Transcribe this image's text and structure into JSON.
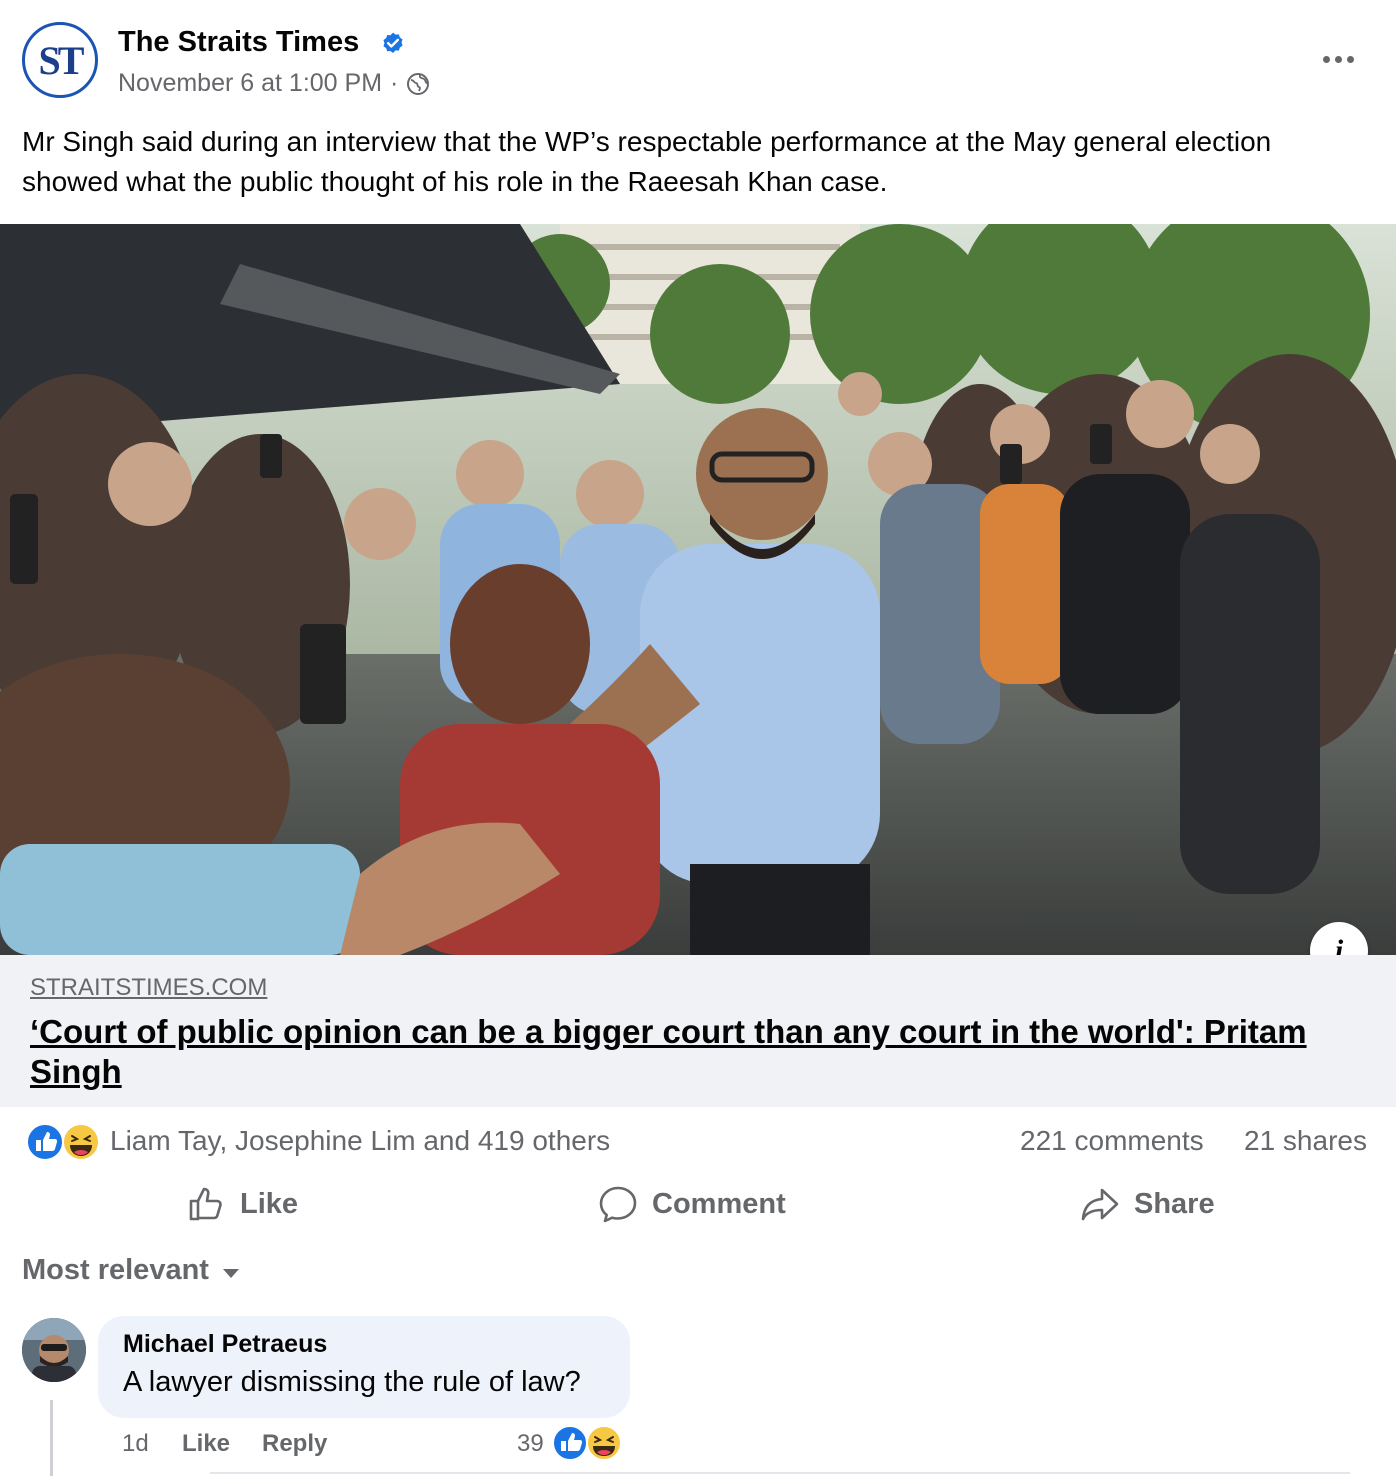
{
  "post": {
    "page_name": "The Straits Times",
    "logo_text": "ST",
    "timestamp": "November 6 at 1:00 PM",
    "separator": "·",
    "privacy_icon": "globe-icon",
    "verified_icon": "verified-badge-icon",
    "more_icon": "more-dots-icon",
    "caption": "Mr Singh said during an interview that the WP’s respectable performance at the May general election showed what the public thought of his role in the Raeesah Khan case."
  },
  "link_preview": {
    "domain": "STRAITSTIMES.COM",
    "title": "‘Court of public opinion can be a bigger court than any court in the world': Pritam Singh",
    "info_icon": "info-icon",
    "info_label": "i"
  },
  "stats": {
    "reactions_text": "Liam Tay, Josephine Lim and 419 others",
    "comments": "221 comments",
    "shares": "21 shares",
    "reaction_icons": [
      "like-icon",
      "haha-icon"
    ]
  },
  "actions": {
    "like": "Like",
    "comment": "Comment",
    "share": "Share"
  },
  "comments_section": {
    "sort_label": "Most relevant",
    "items": [
      {
        "author": "Michael Petraeus",
        "text": "A lawyer dismissing the rule of law?",
        "age": "1d",
        "like": "Like",
        "reply": "Reply",
        "reaction_count": "39"
      }
    ]
  },
  "colors": {
    "facebook_blue": "#1b74e4",
    "secondary_text": "#65676b",
    "st_blue": "#1b54b3",
    "link_bg": "#f0f2f5"
  }
}
